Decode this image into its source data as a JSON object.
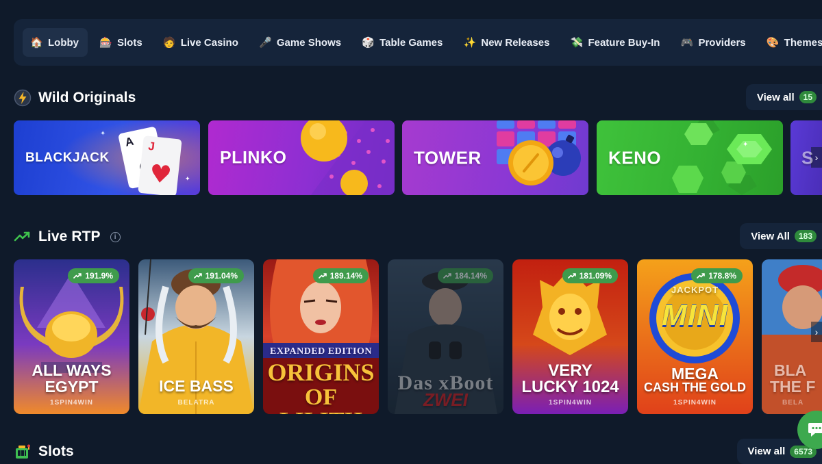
{
  "nav": {
    "items": [
      {
        "label": "Lobby",
        "icon": "house-icon"
      },
      {
        "label": "Slots",
        "icon": "slot-machine-icon"
      },
      {
        "label": "Live Casino",
        "icon": "dealer-icon"
      },
      {
        "label": "Game Shows",
        "icon": "microphone-icon"
      },
      {
        "label": "Table Games",
        "icon": "dice-icon"
      },
      {
        "label": "New Releases",
        "icon": "sparkles-icon"
      },
      {
        "label": "Feature Buy-In",
        "icon": "money-icon"
      },
      {
        "label": "Providers",
        "icon": "controller-icon"
      },
      {
        "label": "Themes",
        "icon": "palette-icon"
      }
    ]
  },
  "originals": {
    "title": "Wild Originals",
    "icon": "lightning-icon",
    "view_all_label": "View all",
    "count": "15",
    "cards": [
      "BLACKJACK",
      "PLINKO",
      "TOWER",
      "KENO",
      "S"
    ]
  },
  "live_rtp": {
    "title": "Live RTP",
    "icon": "trend-up-icon",
    "info_icon": "info-icon",
    "view_all_label": "View All",
    "count": "183",
    "games": [
      {
        "title_line1": "ALL WAYS",
        "title_line2": "EGYPT",
        "provider": "1SPIN4WIN",
        "rtp": "191.9%"
      },
      {
        "title_line1": "ICE BASS",
        "title_line2": "",
        "provider": "BELATRA",
        "rtp": "191.04%"
      },
      {
        "title_line1": "EXPANDED EDITION",
        "title_line2": "ORIGINS",
        "title_line3": "OF LILITH",
        "provider": "",
        "rtp": "189.14%"
      },
      {
        "title_line1": "Das xBoot",
        "title_line2": "ZWEI",
        "provider": "",
        "rtp": "184.14%"
      },
      {
        "title_line1": "VERY",
        "title_line2": "LUCKY 1024",
        "provider": "1SPIN4WIN",
        "rtp": "181.09%"
      },
      {
        "title_line1": "MEGA",
        "title_line2": "CASH THE GOLD",
        "provider": "1SPIN4WIN",
        "rtp": "178.8%",
        "logo_text": "MINI",
        "ring_text": "JACKPOT"
      },
      {
        "title_line1": "BLA",
        "title_line2": "THE F",
        "provider": "BELA",
        "rtp": ""
      }
    ]
  },
  "slots": {
    "title": "Slots",
    "icon": "slot-machine-icon",
    "view_all_label": "View all",
    "count": "6573"
  },
  "colors": {
    "background": "#0f1a2a",
    "panel": "#15243a",
    "accent_green": "#3f9b4c"
  },
  "chat": {
    "icon": "chat-icon"
  }
}
